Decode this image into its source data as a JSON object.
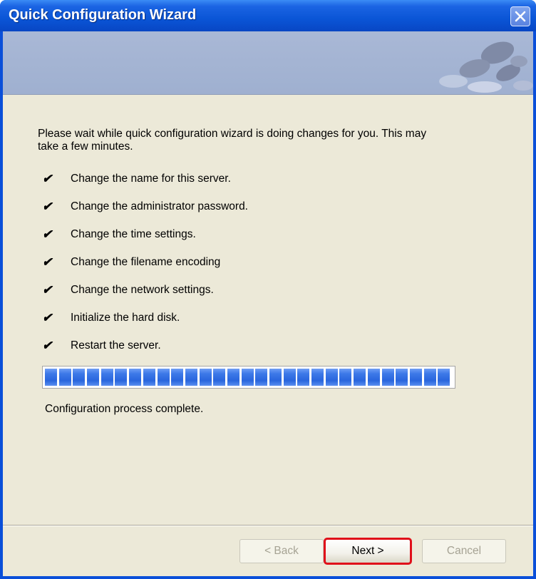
{
  "window": {
    "title": "Quick Configuration Wizard"
  },
  "content": {
    "intro": "Please wait while quick configuration wizard is doing changes for you.  This may take a few minutes.",
    "steps": [
      {
        "check": "✔",
        "label": "Change the name for this server."
      },
      {
        "check": "✔",
        "label": "Change the administrator password."
      },
      {
        "check": "✔",
        "label": "Change the time settings."
      },
      {
        "check": "✔",
        "label": "Change the filename encoding"
      },
      {
        "check": "✔",
        "label": "Change the network settings."
      },
      {
        "check": "✔",
        "label": "Initialize the hard disk."
      },
      {
        "check": "✔",
        "label": "Restart the server."
      }
    ],
    "progress_fraction": 1.0,
    "status": "Configuration process complete."
  },
  "buttons": {
    "back": "< Back",
    "next": "Next >",
    "cancel": "Cancel"
  },
  "colors": {
    "titlebar": "#0a55d6",
    "progress_block": "#3c78e8",
    "highlight": "#e0101a",
    "dialog_bg": "#ece9d8"
  }
}
